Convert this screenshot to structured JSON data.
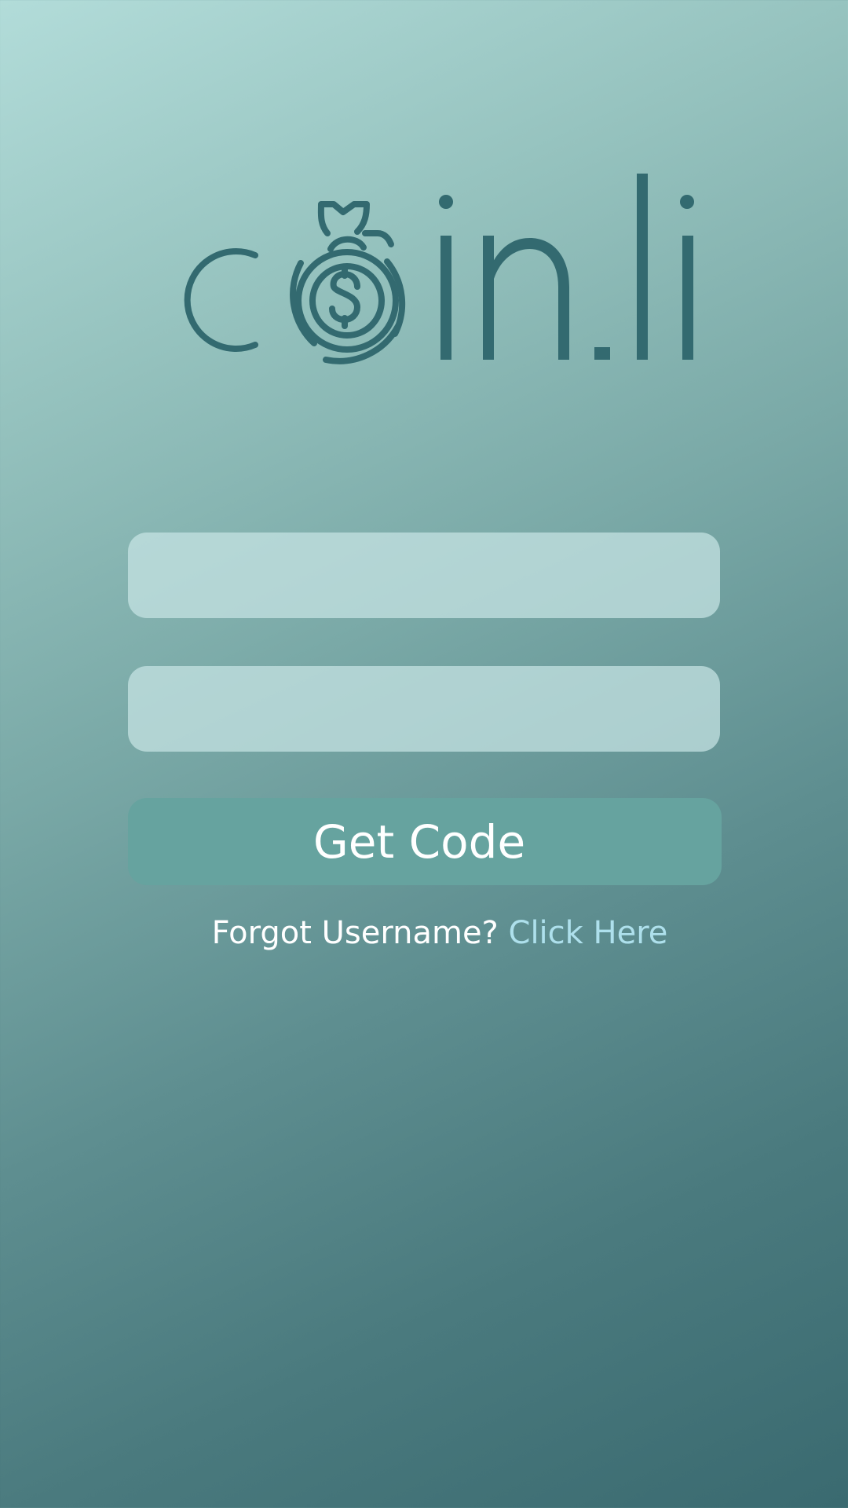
{
  "app": {
    "brand": "coin.li"
  },
  "form": {
    "username": {
      "value": "",
      "placeholder": ""
    },
    "code": {
      "value": "",
      "placeholder": ""
    },
    "submit_label": "Get Code"
  },
  "footer": {
    "forgot_prompt": "Forgot Username?",
    "forgot_link": "Click Here"
  },
  "colors": {
    "logo": "#336a70",
    "button": "#66a39f",
    "link": "#aee0ec",
    "field": "#c8e4e4"
  },
  "icons": {
    "logo_mark": "money-bag-coin-icon"
  }
}
